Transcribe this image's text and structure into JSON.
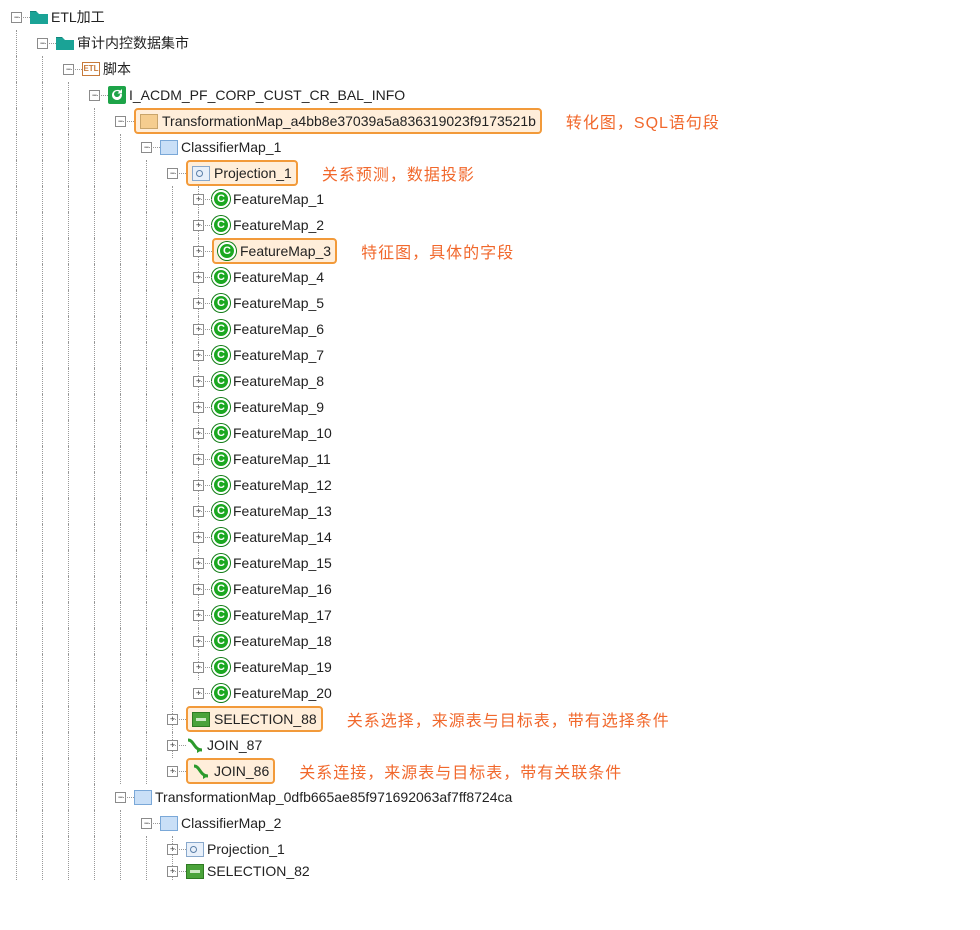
{
  "tree": {
    "root": {
      "label": "ETL加工"
    },
    "audit": {
      "label": "审计内控数据集市"
    },
    "script": {
      "label": "脚本",
      "icon_text": "ETL"
    },
    "job": {
      "label": "I_ACDM_PF_CORP_CUST_CR_BAL_INFO"
    },
    "tmap1": {
      "label": "TransformationMap_a4bb8e37039a5a836319023f9173521b",
      "annot": "转化图，SQL语句段"
    },
    "cmap1": {
      "label": "ClassifierMap_1"
    },
    "proj1": {
      "label": "Projection_1",
      "annot": "关系预测，数据投影"
    },
    "features": [
      "FeatureMap_1",
      "FeatureMap_2",
      "FeatureMap_3",
      "FeatureMap_4",
      "FeatureMap_5",
      "FeatureMap_6",
      "FeatureMap_7",
      "FeatureMap_8",
      "FeatureMap_9",
      "FeatureMap_10",
      "FeatureMap_11",
      "FeatureMap_12",
      "FeatureMap_13",
      "FeatureMap_14",
      "FeatureMap_15",
      "FeatureMap_16",
      "FeatureMap_17",
      "FeatureMap_18",
      "FeatureMap_19",
      "FeatureMap_20"
    ],
    "feature_annot_index": 2,
    "feature_annot": "特征图，具体的字段",
    "sel88": {
      "label": "SELECTION_88",
      "annot": "关系选择，来源表与目标表，带有选择条件"
    },
    "join87": {
      "label": "JOIN_87"
    },
    "join86": {
      "label": "JOIN_86",
      "annot": "关系连接，来源表与目标表，带有关联条件"
    },
    "tmap2": {
      "label": "TransformationMap_0dfb665ae85f971692063af7ff8724ca"
    },
    "cmap2": {
      "label": "ClassifierMap_2"
    },
    "proj2": {
      "label": "Projection_1"
    },
    "sel82": {
      "label": "SELECTION_82"
    }
  },
  "glyph": {
    "plus": "+",
    "minus": "−",
    "feature_c": "C"
  }
}
